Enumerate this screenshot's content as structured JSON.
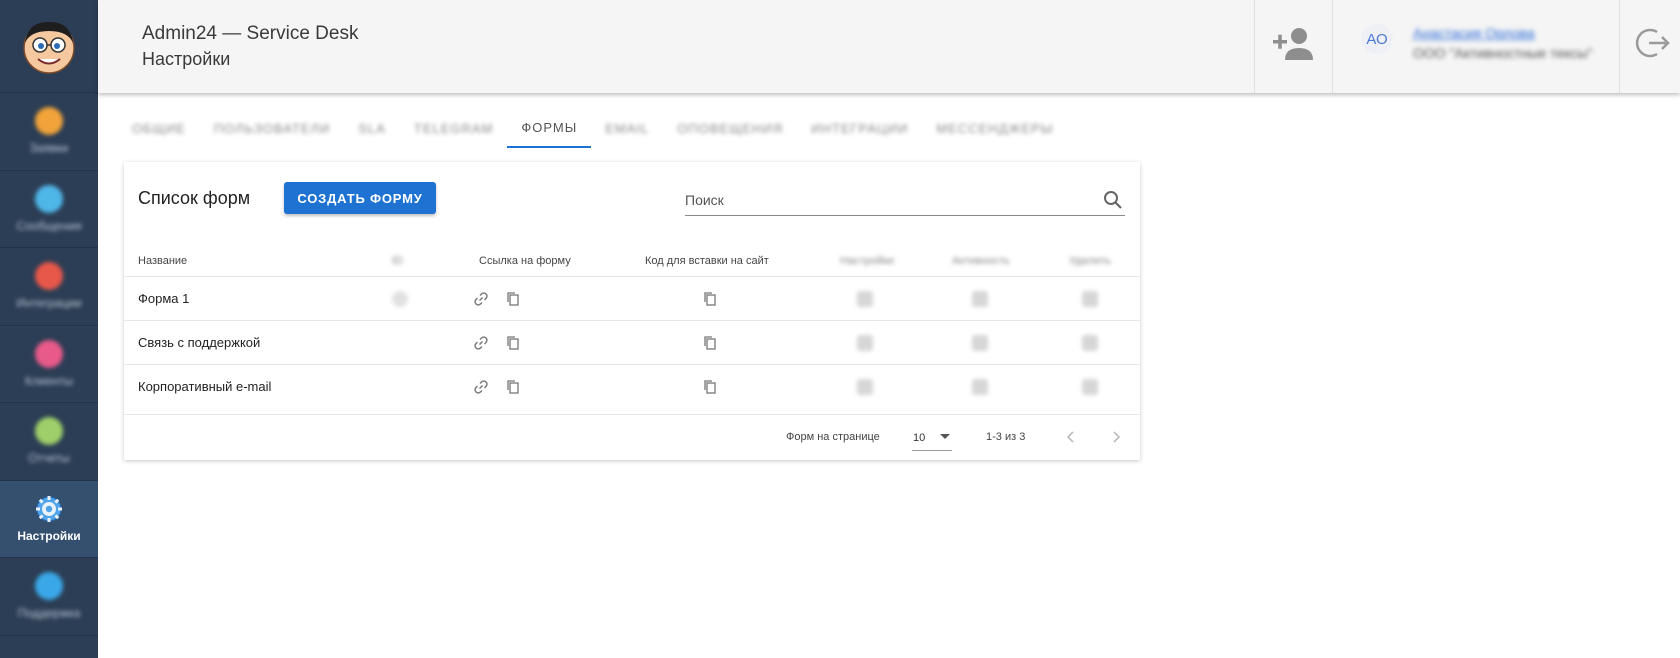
{
  "sidebar": {
    "items": [
      {
        "label": "Заявки",
        "icon": "tickets-icon",
        "color": "#f2a33a",
        "active": false
      },
      {
        "label": "Сообщения",
        "icon": "messages-icon",
        "color": "#4fb6e8",
        "active": false
      },
      {
        "label": "Интеграции",
        "icon": "integrations-icon",
        "color": "#e8584a",
        "active": false
      },
      {
        "label": "Клиенты",
        "icon": "clients-icon",
        "color": "#e85a8a",
        "active": false
      },
      {
        "label": "Отчеты",
        "icon": "reports-icon",
        "color": "#9fcf6a",
        "active": false
      },
      {
        "label": "Настройки",
        "icon": "gear-icon",
        "color": "#4fa3e8",
        "active": true
      },
      {
        "label": "Поддержка",
        "icon": "support-icon",
        "color": "#3aa8e8",
        "active": false
      }
    ]
  },
  "header": {
    "title": "Admin24 — Service Desk",
    "subtitle": "Настройки",
    "avatar_initials": "АО",
    "user_name": "Анастасия Орлова",
    "user_org": "ООО \"Активностные тексы\""
  },
  "tabs": [
    {
      "label": "ОБЩИЕ",
      "active": false
    },
    {
      "label": "ПОЛЬЗОВАТЕЛИ",
      "active": false
    },
    {
      "label": "SLA",
      "active": false
    },
    {
      "label": "TELEGRAM",
      "active": false
    },
    {
      "label": "ФОРМЫ",
      "active": true
    },
    {
      "label": "EMAIL",
      "active": false
    },
    {
      "label": "ОПОВЕЩЕНИЯ",
      "active": false
    },
    {
      "label": "ИНТЕГРАЦИИ",
      "active": false
    },
    {
      "label": "МЕССЕНДЖЕРЫ",
      "active": false
    }
  ],
  "forms_card": {
    "title": "Список форм",
    "create_button": "СОЗДАТЬ ФОРМУ",
    "search_placeholder": "Поиск",
    "columns": {
      "name": "Название",
      "id": "ID",
      "link": "Ссылка на форму",
      "embed": "Код для вставки на сайт",
      "settings": "Настройки",
      "active": "Активность",
      "delete": "Удалить"
    },
    "rows": [
      {
        "name": "Форма 1"
      },
      {
        "name": "Связь с поддержкой"
      },
      {
        "name": "Корпоративный e-mail"
      }
    ],
    "footer": {
      "per_page_label": "Форм на странице",
      "per_page_value": "10",
      "range": "1-3 из 3"
    }
  },
  "colors": {
    "primary": "#1e73d2",
    "sidebar_bg": "#2c3e55",
    "header_bg": "#f5f5f5"
  }
}
